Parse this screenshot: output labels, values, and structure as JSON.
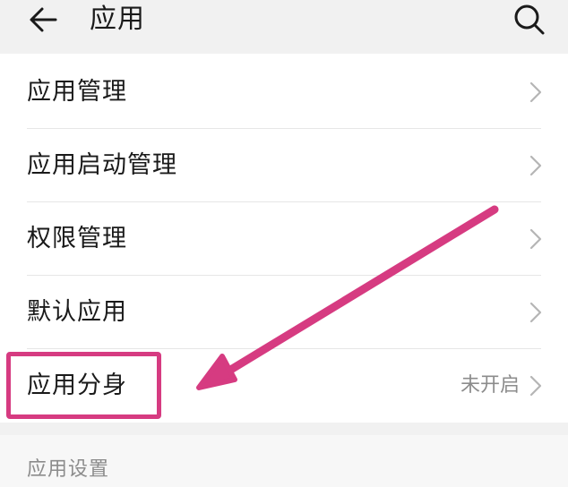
{
  "header": {
    "title": "应用"
  },
  "menu": {
    "items": [
      {
        "label": "应用管理",
        "value": ""
      },
      {
        "label": "应用启动管理",
        "value": ""
      },
      {
        "label": "权限管理",
        "value": ""
      },
      {
        "label": "默认应用",
        "value": ""
      },
      {
        "label": "应用分身",
        "value": "未开启"
      }
    ]
  },
  "section": {
    "label": "应用设置"
  },
  "icons": {
    "back": "back-arrow-icon",
    "search": "search-icon",
    "chevron": "chevron-right-icon"
  },
  "colors": {
    "annotation": "#d63b81",
    "text_primary": "#1a1a1a",
    "text_secondary": "#8c8c8c"
  }
}
